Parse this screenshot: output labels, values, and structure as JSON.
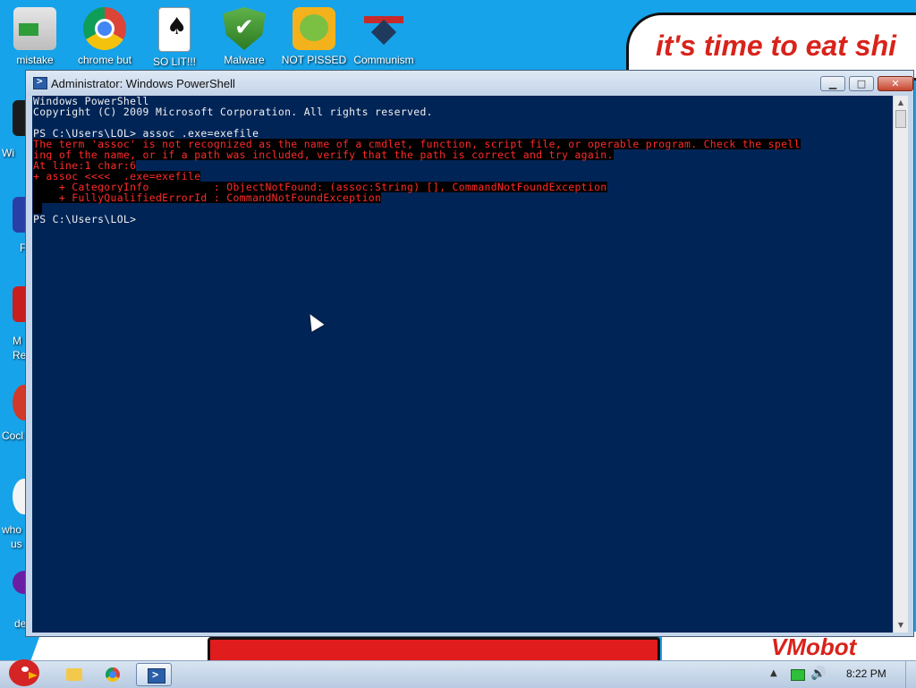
{
  "wallpaper": {
    "banner_text": "it's time to eat shi",
    "bottom_text": "VMobot",
    "left_labels": [
      "Wi",
      "F",
      "M",
      "Re",
      "Cocl",
      "who",
      "us",
      "de"
    ]
  },
  "desktop_icons": [
    {
      "label": "mistake",
      "icon": "installer-icon"
    },
    {
      "label": "chrome but",
      "icon": "chrome-icon"
    },
    {
      "label": "SO LIT!!!",
      "icon": "playing-card-icon"
    },
    {
      "label": "Malware",
      "icon": "shield-check-icon"
    },
    {
      "label": "NOT PISSED",
      "icon": "pig-icon"
    },
    {
      "label": "Communism",
      "icon": "emblem-icon"
    }
  ],
  "window": {
    "title": "Administrator: Windows PowerShell",
    "minimize": "▁",
    "maximize": "□",
    "close": "✕"
  },
  "console": {
    "lines": [
      {
        "text": "Windows PowerShell",
        "type": "normal"
      },
      {
        "text": "Copyright (C) 2009 Microsoft Corporation. All rights reserved.",
        "type": "normal"
      },
      {
        "text": "",
        "type": "normal"
      },
      {
        "text": "PS C:\\Users\\LOL> assoc .exe=exefile",
        "type": "normal"
      },
      {
        "text": "The term 'assoc' is not recognized as the name of a cmdlet, function, script file, or operable program. Check the spell",
        "type": "err"
      },
      {
        "text": "ing of the name, or if a path was included, verify that the path is correct and try again.",
        "type": "err"
      },
      {
        "text": "At line:1 char:6",
        "type": "err"
      },
      {
        "text": "+ assoc <<<<  .exe=exefile",
        "type": "err"
      },
      {
        "text": "    + CategoryInfo          : ObjectNotFound: (assoc:String) [], CommandNotFoundException",
        "type": "err"
      },
      {
        "text": "    + FullyQualifiedErrorId : CommandNotFoundException",
        "type": "err"
      },
      {
        "text": " ",
        "type": "err"
      },
      {
        "text": "PS C:\\Users\\LOL>",
        "type": "normal"
      }
    ]
  },
  "taskbar": {
    "items": [
      "folder-icon",
      "chrome-icon",
      "powershell-icon"
    ],
    "clock": "8:22 PM",
    "tray": [
      "show-hidden-icons",
      "network-icon",
      "volume-icon"
    ]
  },
  "colors": {
    "console_bg": "#012456",
    "error_fg": "#ff2a2a",
    "normal_fg": "#f0f0f0"
  }
}
